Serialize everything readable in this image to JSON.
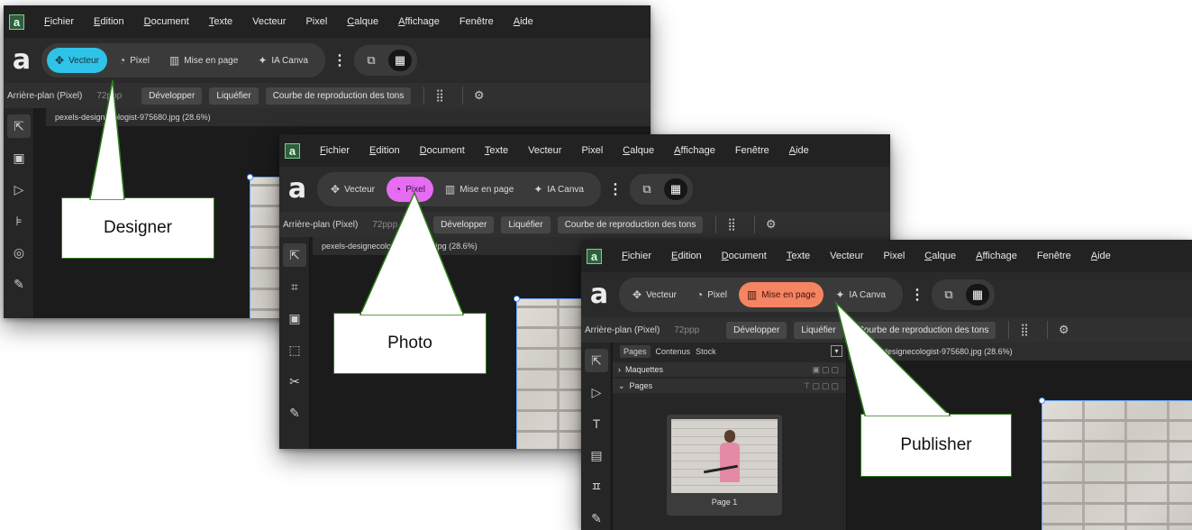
{
  "menu": {
    "items": [
      {
        "label": "Fichier",
        "ul": "F",
        "rest": "ichier"
      },
      {
        "label": "Edition",
        "ul": "E",
        "rest": "dition"
      },
      {
        "label": "Document",
        "ul": "D",
        "rest": "ocument"
      },
      {
        "label": "Texte",
        "ul": "T",
        "rest": "exte"
      },
      {
        "label": "Vecteur",
        "ul": "",
        "rest": "Vecteur"
      },
      {
        "label": "Pixel",
        "ul": "",
        "rest": "Pixel"
      },
      {
        "label": "Calque",
        "ul": "C",
        "rest": "alque"
      },
      {
        "label": "Affichage",
        "ul": "A",
        "rest": "ffichage"
      },
      {
        "label": "Fenêtre",
        "ul": "",
        "rest": "Fenêtre"
      },
      {
        "label": "Aide",
        "ul": "A",
        "rest": "ide"
      }
    ],
    "logo": "a"
  },
  "personas": {
    "app_glyph": "a",
    "vecteur": "Vecteur",
    "pixel": "Pixel",
    "mise_en_page": "Mise en page",
    "ia_canva": "IA Canva",
    "more": "⋮",
    "active_colors": {
      "designer": "#2fc3e7",
      "photo": "#e66cf2",
      "publisher": "#f58462"
    }
  },
  "context": {
    "layer": "Arrière-plan (Pixel)",
    "dpi": "72ppp",
    "developper": "Développer",
    "liquefier": "Liquéfier",
    "courbe": "Courbe de reproduction des tons"
  },
  "documents": {
    "designer_tab": "pexels-designecologist-975680.jpg (28.6%)",
    "photo_tab": "pexels-designecologist-975680.jpg (28.6%)",
    "publisher_tab": "pexels-designecologist-975680.jpg (28.6%)"
  },
  "publisher_panel": {
    "tabs": [
      "Pages",
      "Contenus",
      "Stock"
    ],
    "maquettes": "Maquettes",
    "pages": "Pages",
    "page_label": "Page 1"
  },
  "callouts": {
    "designer": "Designer",
    "photo": "Photo",
    "publisher": "Publisher"
  },
  "icons": [
    "vector-pen-icon",
    "pixel-brush-icon",
    "layout-icon",
    "ai-sparkle-icon",
    "more-icon",
    "studio-toggle-icon",
    "grid-toggle-icon",
    "settings-gear-icon",
    "move-tool-icon",
    "node-tool-icon"
  ]
}
